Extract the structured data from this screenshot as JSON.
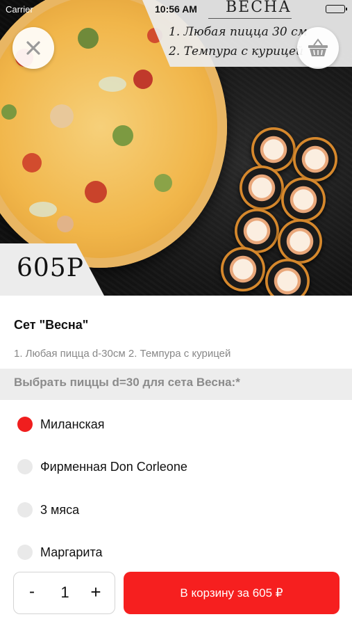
{
  "status_bar": {
    "carrier": "Carrier",
    "time": "10:56 AM"
  },
  "banner": {
    "title": "ВЕСНА",
    "line1": "1. Любая пицца 30 см",
    "line2": "2. Темпура с курицей"
  },
  "hero": {
    "price_badge": "605Р"
  },
  "icons": {
    "close": "close-icon",
    "cart": "basket-icon"
  },
  "product": {
    "title": "Сет \"Весна\"",
    "description": "1. Любая пицца d-30см 2. Темпура с курицей"
  },
  "options_section": {
    "label": "Выбрать пиццы d=30 для сета Весна:*",
    "options": [
      {
        "label": "Миланская",
        "selected": true
      },
      {
        "label": "Фирменная Don Corleone",
        "selected": false
      },
      {
        "label": "3 мяса",
        "selected": false
      },
      {
        "label": "Маргарита",
        "selected": false
      }
    ]
  },
  "bottom": {
    "minus": "-",
    "quantity": "1",
    "plus": "+",
    "add_to_cart": "В корзину за 605 ₽"
  },
  "colors": {
    "accent": "#f61f1f",
    "selected_radio": "#f01e1e",
    "section_bg": "#ededed"
  }
}
